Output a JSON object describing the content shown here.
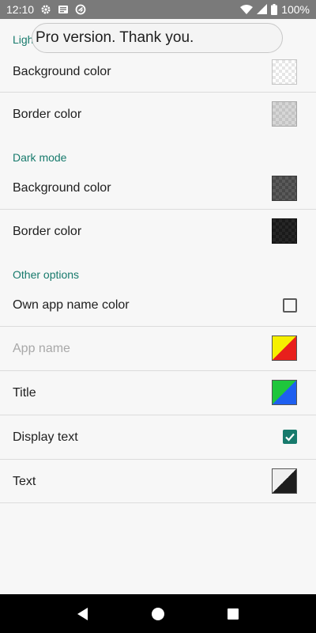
{
  "status_bar": {
    "time": "12:10",
    "left_icons": [
      "gear-icon",
      "newspaper-icon",
      "sync-icon"
    ],
    "right_icons": [
      "wifi-icon",
      "signal-icon",
      "battery-icon"
    ],
    "battery": "100%"
  },
  "toast": {
    "text": "Pro version. Thank you."
  },
  "sections": {
    "light": {
      "header": "Ligh",
      "background_color_label": "Background color",
      "border_color_label": "Border color"
    },
    "dark": {
      "header": "Dark mode",
      "background_color_label": "Background color",
      "border_color_label": "Border color"
    },
    "other": {
      "header": "Other options",
      "own_app_name_color_label": "Own app name color",
      "own_app_name_color_checked": false,
      "app_name_label": "App name",
      "title_label": "Title",
      "display_text_label": "Display text",
      "display_text_checked": true,
      "text_label": "Text"
    }
  },
  "swatch_colors": {
    "app_name": [
      "#f6f000",
      "#e8201c"
    ],
    "title": [
      "#1fc63c",
      "#1e5ff0"
    ],
    "text": [
      "#f0f0f0",
      "#1e1e1e"
    ]
  },
  "accent_color": "#177a6c",
  "nav_bar": {
    "icons": [
      "back-icon",
      "home-icon",
      "recents-icon"
    ]
  }
}
